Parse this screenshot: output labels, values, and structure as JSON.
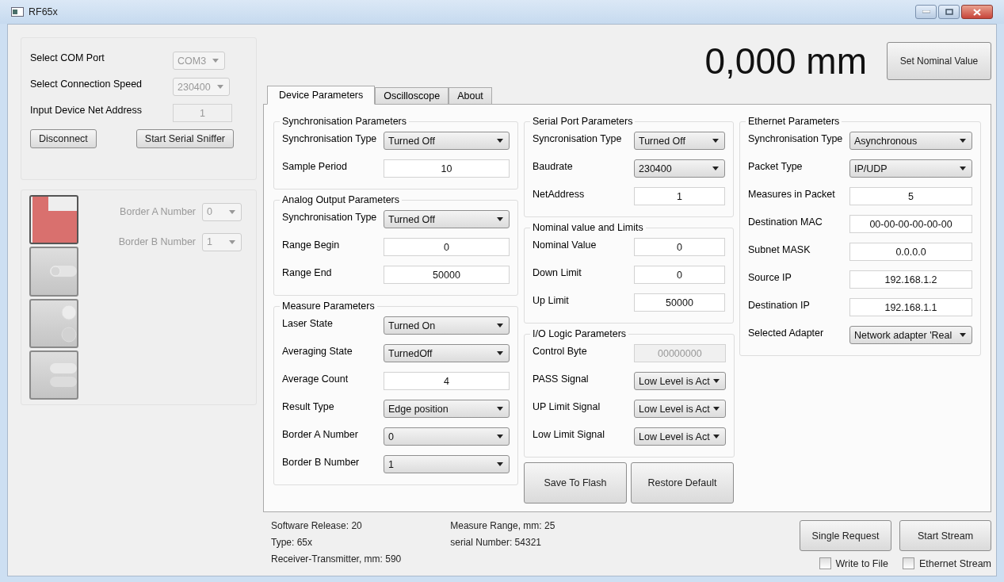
{
  "window": {
    "title": "RF65x"
  },
  "connection": {
    "rows": [
      {
        "label": "Select COM Port",
        "kind": "combo",
        "value": "COM3",
        "disabled": true
      },
      {
        "label": "Select Connection Speed",
        "kind": "combo",
        "value": "230400",
        "disabled": true
      },
      {
        "label": "Input Device Net Address",
        "kind": "input",
        "value": "1",
        "disabled": true
      }
    ],
    "buttons": [
      "Disconnect",
      "Start Serial Sniffer"
    ]
  },
  "modes": [
    {
      "kind": "notch",
      "selected": true
    },
    {
      "kind": "slider",
      "selected": false
    },
    {
      "kind": "circles",
      "selected": false
    },
    {
      "kind": "double-slider",
      "selected": false
    }
  ],
  "borders": [
    {
      "label": "Border A Number",
      "kind": "combo",
      "value": "0",
      "disabled": true
    },
    {
      "label": "Border B Number",
      "kind": "combo",
      "value": "1",
      "disabled": true
    }
  ],
  "reading": "0,000 mm",
  "set_nominal_button": "Set Nominal Value",
  "tabs": [
    {
      "label": "Device Parameters",
      "selected": true
    },
    {
      "label": "Oscilloscope",
      "selected": false
    },
    {
      "label": "About",
      "selected": false
    }
  ],
  "columns": [
    [
      {
        "title": "Synchronisation Parameters",
        "rows": [
          {
            "label": "Synchronisation Type",
            "kind": "combo",
            "value": "Turned Off",
            "disabled": false
          },
          {
            "label": "Sample Period",
            "kind": "input",
            "value": "10",
            "disabled": false
          }
        ]
      },
      {
        "title": "Analog Output Parameters",
        "rows": [
          {
            "label": "Synchronisation Type",
            "kind": "combo",
            "value": "Turned Off",
            "disabled": false
          },
          {
            "label": "Range Begin",
            "kind": "input",
            "value": "0",
            "disabled": false
          },
          {
            "label": "Range End",
            "kind": "input",
            "value": "50000",
            "disabled": false
          }
        ]
      },
      {
        "title": "Measure Parameters",
        "rows": [
          {
            "label": "Laser State",
            "kind": "combo",
            "value": "Turned On",
            "disabled": false
          },
          {
            "label": "Averaging State",
            "kind": "combo",
            "value": "TurnedOff",
            "disabled": false
          },
          {
            "label": "Average Count",
            "kind": "input",
            "value": "4",
            "disabled": false
          },
          {
            "label": "Result Type",
            "kind": "combo",
            "value": "Edge position",
            "disabled": false
          },
          {
            "label": "Border A Number",
            "kind": "combo",
            "value": "0",
            "disabled": false
          },
          {
            "label": "Border B Number",
            "kind": "combo",
            "value": "1",
            "disabled": false
          }
        ]
      }
    ],
    [
      {
        "title": "Serial Port Parameters",
        "rows": [
          {
            "label": "Syncronisation Type",
            "kind": "combo",
            "value": "Turned Off",
            "disabled": false
          },
          {
            "label": "Baudrate",
            "kind": "combo",
            "value": "230400",
            "disabled": false
          },
          {
            "label": "NetAddress",
            "kind": "input",
            "value": "1",
            "disabled": false
          }
        ]
      },
      {
        "title": "Nominal value and Limits",
        "rows": [
          {
            "label": "Nominal Value",
            "kind": "input",
            "value": "0",
            "disabled": false
          },
          {
            "label": "Down Limit",
            "kind": "input",
            "value": "0",
            "disabled": false
          },
          {
            "label": "Up Limit",
            "kind": "input",
            "value": "50000",
            "disabled": false
          }
        ]
      },
      {
        "title": "I/O Logic Parameters",
        "rows": [
          {
            "label": "Control Byte",
            "kind": "input",
            "value": "00000000",
            "disabled": true
          },
          {
            "label": "PASS Signal",
            "kind": "combo",
            "value": "Low Level is Act",
            "disabled": false
          },
          {
            "label": "UP Limit Signal",
            "kind": "combo",
            "value": "Low Level is Act",
            "disabled": false
          },
          {
            "label": "Low Limit Signal",
            "kind": "combo",
            "value": "Low Level is Act",
            "disabled": false
          }
        ]
      }
    ],
    [
      {
        "title": "Ethernet Parameters",
        "rows": [
          {
            "label": "Synchronisation Type",
            "kind": "combo",
            "value": "Asynchronous",
            "disabled": false
          },
          {
            "label": "Packet Type",
            "kind": "combo",
            "value": "IP/UDP",
            "disabled": false
          },
          {
            "label": "Measures in Packet",
            "kind": "input",
            "value": "5",
            "disabled": false
          },
          {
            "label": "Destination MAC",
            "kind": "input",
            "value": "00-00-00-00-00-00",
            "disabled": false
          },
          {
            "label": "Subnet MASK",
            "kind": "input",
            "value": "0.0.0.0",
            "disabled": false
          },
          {
            "label": "Source IP",
            "kind": "input",
            "value": "192.168.1.2",
            "disabled": false
          },
          {
            "label": "Destination IP",
            "kind": "input",
            "value": "192.168.1.1",
            "disabled": false
          },
          {
            "label": "Selected Adapter",
            "kind": "combo",
            "value": "Network adapter 'Real",
            "disabled": false
          }
        ]
      }
    ]
  ],
  "flash_buttons": [
    "Save To Flash",
    "Restore Default"
  ],
  "info": [
    [
      "Software Release: 20",
      "Type: 65x",
      "Receiver-Transmitter, mm: 590"
    ],
    [
      "Measure Range, mm: 25",
      "serial Number: 54321"
    ]
  ],
  "stream_buttons": [
    "Single Request",
    "Start Stream"
  ],
  "checkboxes": [
    {
      "label": "Write to File",
      "checked": false
    },
    {
      "label": "Ethernet Stream",
      "checked": false
    }
  ]
}
